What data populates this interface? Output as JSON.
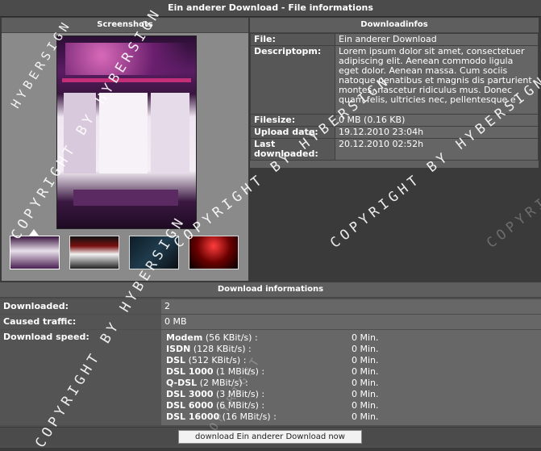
{
  "window": {
    "title": "Ein anderer Download - File informations"
  },
  "screenshots": {
    "header": "Screenshots",
    "thumbnail_count": 4,
    "selected_thumbnail": 1
  },
  "downloadinfos": {
    "header": "Downloadinfos",
    "rows": [
      {
        "key": "File:",
        "value": "Ein anderer Download"
      },
      {
        "key": "Descriptopm:",
        "value": "Lorem ipsum dolor sit amet, consectetuer adipiscing elit. Aenean commodo ligula eget dolor. Aenean massa. Cum sociis natoque penatibus et magnis dis parturient montes, nascetur ridiculus mus. Donec quam felis, ultricies nec, pellentesque e"
      },
      {
        "key": "Filesize:",
        "value": "0 MB (0.16 KB)"
      },
      {
        "key": "Upload date:",
        "value": "19.12.2010 23:04h"
      },
      {
        "key": "Last downloaded:",
        "value": "20.12.2010 02:52h"
      }
    ]
  },
  "download_informations": {
    "header": "Download informations",
    "downloaded_label": "Downloaded:",
    "downloaded_value": "2",
    "traffic_label": "Caused traffic:",
    "traffic_value": "0 MB",
    "speed_label": "Download speed:",
    "speeds": [
      {
        "name": "Modem",
        "rate": "(56 KBit/s) :",
        "time": "0 Min."
      },
      {
        "name": "ISDN",
        "rate": "(128 KBit/s) :",
        "time": "0 Min."
      },
      {
        "name": "DSL",
        "rate": "(512 KBit/s) :",
        "time": "0 Min."
      },
      {
        "name": "DSL 1000",
        "rate": "(1 MBit/s) :",
        "time": "0 Min."
      },
      {
        "name": "Q-DSL",
        "rate": "(2 MBit/s) :",
        "time": "0 Min."
      },
      {
        "name": "DSL 3000",
        "rate": "(3 MBit/s) :",
        "time": "0 Min."
      },
      {
        "name": "DSL 6000",
        "rate": "(6 MBit/s) :",
        "time": "0 Min."
      },
      {
        "name": "DSL 16000",
        "rate": "(16 MBit/s) :",
        "time": "0 Min."
      }
    ]
  },
  "download_button": "download Ein anderer Download now",
  "watermark": {
    "text_1": "COPYRIGHT BY HYBERSIGN",
    "text_2": "HYBERSIGN",
    "text_3": "COPYRIGHT",
    "text_4": "COPYRIGHT BY HYBERSIGN",
    "text_5": "COPYRIGHT BY HYBERSIGN",
    "text_6": "COPYRI"
  }
}
